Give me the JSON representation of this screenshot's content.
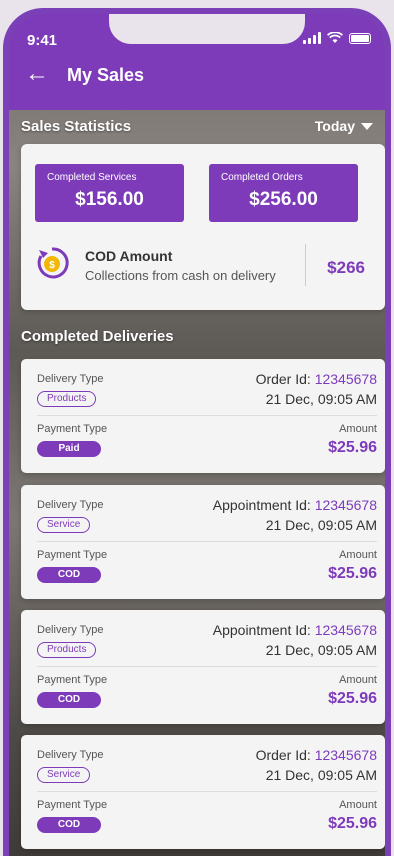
{
  "status_bar": {
    "time": "9:41"
  },
  "header": {
    "title": "My Sales"
  },
  "stats": {
    "section_title": "Sales Statistics",
    "filter": "Today",
    "completed_services_label": "Completed Services",
    "completed_services_value": "$156.00",
    "completed_orders_label": "Completed Orders",
    "completed_orders_value": "$256.00",
    "cod_title": "COD Amount",
    "cod_subtitle": "Collections from cash on delivery",
    "cod_value": "$266"
  },
  "deliveries": {
    "section_title": "Completed Deliveries",
    "items": [
      {
        "delivery_type_label": "Delivery Type",
        "delivery_type": "Products",
        "id_label": "Order Id:",
        "id": "12345678",
        "date": "21 Dec, 09:05 AM",
        "payment_type_label": "Payment Type",
        "payment_type": "Paid",
        "amount_label": "Amount",
        "amount": "$25.96"
      },
      {
        "delivery_type_label": "Delivery Type",
        "delivery_type": "Service",
        "id_label": "Appointment Id:",
        "id": "12345678",
        "date": "21 Dec, 09:05 AM",
        "payment_type_label": "Payment Type",
        "payment_type": "COD",
        "amount_label": "Amount",
        "amount": "$25.96"
      },
      {
        "delivery_type_label": "Delivery Type",
        "delivery_type": "Products",
        "id_label": "Appointment Id:",
        "id": "12345678",
        "date": "21 Dec, 09:05 AM",
        "payment_type_label": "Payment Type",
        "payment_type": "COD",
        "amount_label": "Amount",
        "amount": "$25.96"
      },
      {
        "delivery_type_label": "Delivery Type",
        "delivery_type": "Service",
        "id_label": "Order Id:",
        "id": "12345678",
        "date": "21 Dec, 09:05 AM",
        "payment_type_label": "Payment Type",
        "payment_type": "COD",
        "amount_label": "Amount",
        "amount": "$25.96"
      }
    ]
  },
  "colors": {
    "accent": "#7d3bb9",
    "card": "#f5f4f5"
  }
}
